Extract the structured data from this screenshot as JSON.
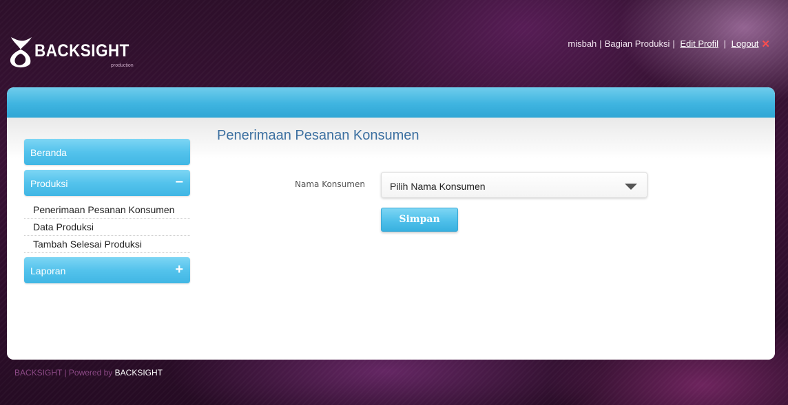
{
  "brand": {
    "name": "BACKSIGHT",
    "sub": "production"
  },
  "topbar": {
    "user": "misbah",
    "role": "Bagian Produksi",
    "edit_profile": "Edit Profil",
    "logout": "Logout",
    "logout_icon": "close-icon",
    "separator": "|"
  },
  "sidebar": {
    "beranda": "Beranda",
    "produksi": "Produksi",
    "produksi_toggle": "−",
    "produksi_items": [
      "Penerimaan Pesanan Konsumen",
      "Data Produksi",
      "Tambah Selesai Produksi"
    ],
    "laporan": "Laporan",
    "laporan_toggle": "+"
  },
  "main": {
    "title": "Penerimaan Pesanan Konsumen",
    "field_label": "Nama Konsumen",
    "select_value": "Pilih Nama Konsumen",
    "submit": "Simpan"
  },
  "footer": {
    "left": "BACKSIGHT | Powered by",
    "brand": "BACKSIGHT"
  },
  "colors": {
    "accent": "#45b9e6",
    "background": "#2d0f2a",
    "title": "#3b6fa0"
  }
}
